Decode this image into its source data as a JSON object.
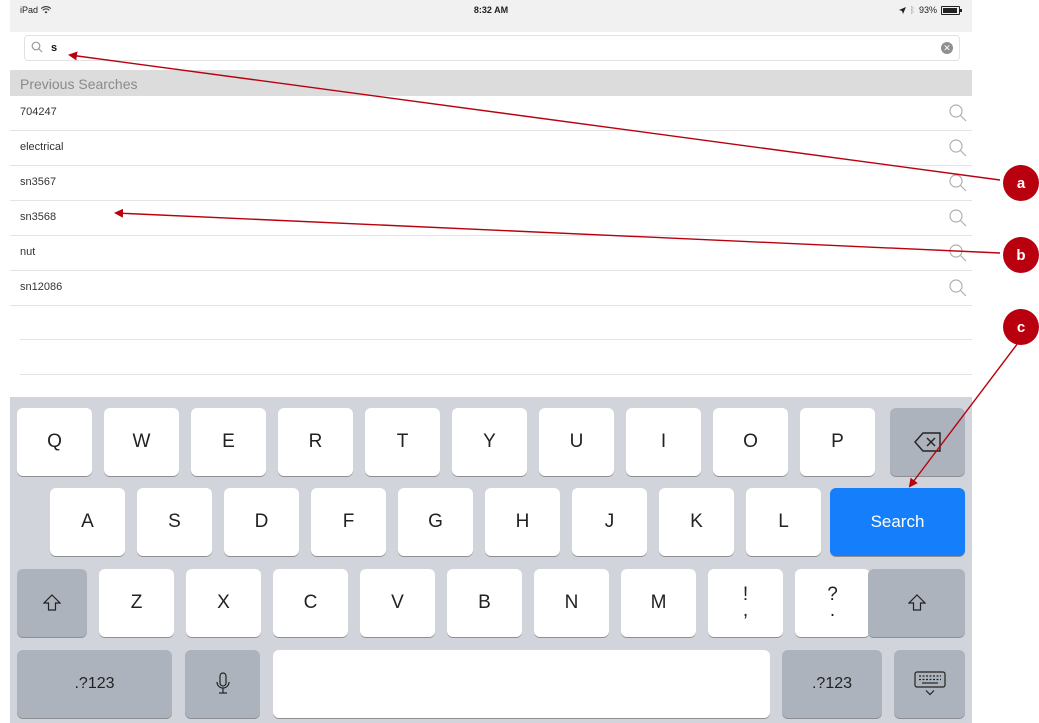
{
  "status_bar": {
    "device": "iPad",
    "time": "8:32 AM",
    "battery": "93%"
  },
  "search": {
    "value": "s",
    "placeholder": ""
  },
  "previous_searches": {
    "header": "Previous Searches",
    "items": [
      "704247",
      "electrical",
      "sn3567",
      "sn3568",
      "nut",
      "sn12086"
    ]
  },
  "keyboard": {
    "row1": [
      "Q",
      "W",
      "E",
      "R",
      "T",
      "Y",
      "U",
      "I",
      "O",
      "P"
    ],
    "row2": [
      "A",
      "S",
      "D",
      "F",
      "G",
      "H",
      "J",
      "K",
      "L"
    ],
    "row3": [
      "Z",
      "X",
      "C",
      "V",
      "B",
      "N",
      "M"
    ],
    "exclaim_top": "!",
    "exclaim_bottom": ",",
    "question_top": "?",
    "question_bottom": ".",
    "search_label": "Search",
    "numbers_label": ".?123"
  },
  "annotations": {
    "a": "a",
    "b": "b",
    "c": "c"
  },
  "colors": {
    "accent": "#147efb",
    "callout": "#b8000e",
    "arrow": "#b8000e"
  }
}
